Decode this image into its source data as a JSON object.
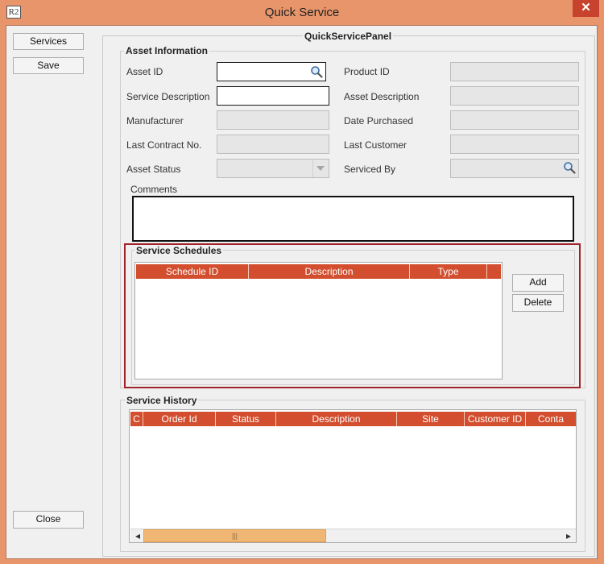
{
  "window": {
    "title": "Quick Service",
    "app_icon_text": "R2",
    "close_glyph": "✕"
  },
  "sidebar": {
    "services_label": "Services",
    "save_label": "Save",
    "close_label": "Close"
  },
  "panel": {
    "title": "QuickServicePanel"
  },
  "asset_info": {
    "title": "Asset Information",
    "asset_id_label": "Asset ID",
    "asset_id_value": "",
    "service_description_label": "Service Description",
    "service_description_value": "",
    "manufacturer_label": "Manufacturer",
    "last_contract_label": "Last Contract No.",
    "asset_status_label": "Asset Status",
    "product_id_label": "Product ID",
    "asset_description_label": "Asset Description",
    "date_purchased_label": "Date Purchased",
    "last_customer_label": "Last Customer",
    "serviced_by_label": "Serviced By",
    "comments_label": "Comments",
    "comments_value": ""
  },
  "service_schedules": {
    "title": "Service Schedules",
    "columns": [
      "Schedule ID",
      "Description",
      "Type"
    ],
    "add_label": "Add",
    "delete_label": "Delete"
  },
  "service_history": {
    "title": "Service History",
    "columns": [
      "C",
      "Order Id",
      "Status",
      "Description",
      "Site",
      "Customer ID",
      "Conta"
    ],
    "scroll_left_glyph": "◂",
    "scroll_right_glyph": "▸",
    "scroll_grip_glyph": "|||"
  },
  "colors": {
    "window_frame": "#e9956b",
    "close_button": "#c7432e",
    "grid_header": "#d24e2e",
    "highlight_border": "#a1232b",
    "scroll_thumb": "#f0b774"
  },
  "icons": {
    "asset_search": "magnifier-icon",
    "serviced_by_search": "magnifier-icon",
    "dropdown": "chevron-down-icon"
  }
}
